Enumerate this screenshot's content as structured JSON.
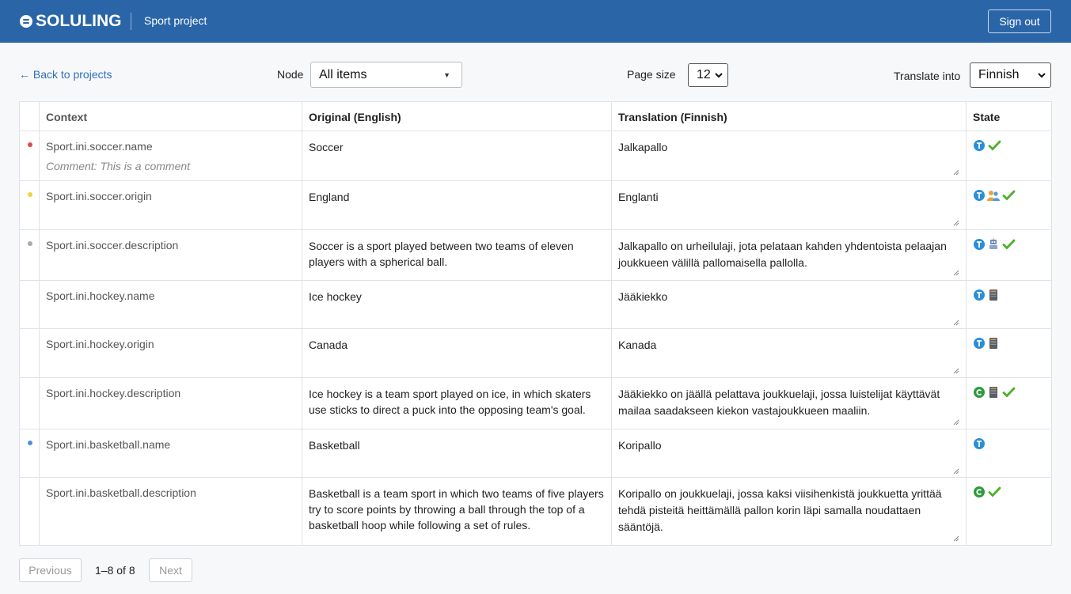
{
  "header": {
    "brand": "SOLULING",
    "project": "Sport project",
    "sign_out": "Sign out"
  },
  "toolbar": {
    "back_link": "← Back to projects",
    "node_label": "Node",
    "node_value": "All items",
    "page_size_label": "Page size",
    "page_size_value": "12",
    "translate_label": "Translate into",
    "translate_value": "Finnish"
  },
  "table": {
    "columns": [
      "Context",
      "Original (English)",
      "Translation (Finnish)",
      "State"
    ],
    "rows": [
      {
        "dot": "#e04848",
        "context": "Sport.ini.soccer.name",
        "comment": "Comment: This is a comment",
        "original": "Soccer",
        "translation": "Jalkapallo",
        "icons": [
          "t-icon",
          "check-icon"
        ]
      },
      {
        "dot": "#f2d43a",
        "context": "Sport.ini.soccer.origin",
        "comment": "",
        "original": "England",
        "translation": "Englanti",
        "icons": [
          "t-icon",
          "users-icon",
          "check-icon"
        ]
      },
      {
        "dot": "#aaaaaa",
        "context": "Sport.ini.soccer.description",
        "comment": "",
        "original": "Soccer is a sport played between two teams of eleven players with a spherical ball.",
        "translation": "Jalkapallo on urheilulaji, jota pelataan kahden yhdentoista pelaajan joukkueen välillä pallomaisella pallolla.",
        "icons": [
          "t-icon",
          "robot-icon",
          "check-icon"
        ]
      },
      {
        "dot": "",
        "context": "Sport.ini.hockey.name",
        "comment": "",
        "original": "Ice hockey",
        "translation": "Jääkiekko",
        "icons": [
          "t-icon",
          "memory-icon"
        ]
      },
      {
        "dot": "",
        "context": "Sport.ini.hockey.origin",
        "comment": "",
        "original": "Canada",
        "translation": "Kanada",
        "icons": [
          "t-icon",
          "memory-icon"
        ]
      },
      {
        "dot": "",
        "context": "Sport.ini.hockey.description",
        "comment": "",
        "original": "Ice hockey is a team sport played on ice, in which skaters use sticks to direct a puck into the opposing team's goal.",
        "translation": "Jääkiekko on jäällä pelattava joukkuelaji, jossa luistelijat käyttävät mailaa saadakseen kiekon vastajoukkueen maaliin.",
        "icons": [
          "c-icon",
          "memory-icon",
          "check-icon"
        ]
      },
      {
        "dot": "#4a90e2",
        "context": "Sport.ini.basketball.name",
        "comment": "",
        "original": "Basketball",
        "translation": "Koripallo",
        "icons": [
          "t-icon"
        ]
      },
      {
        "dot": "",
        "context": "Sport.ini.basketball.description",
        "comment": "",
        "original": "Basketball is a team sport in which two teams of five players try to score points by throwing a ball through the top of a basketball hoop while following a set of rules.",
        "translation": "Koripallo on joukkuelaji, jossa kaksi viisihenkistä joukkuetta yrittää tehdä pisteitä heittämällä pallon korin läpi samalla noudattaen sääntöjä.",
        "icons": [
          "c-icon",
          "check-icon"
        ]
      }
    ]
  },
  "pager": {
    "previous": "Previous",
    "info": "1–8 of 8",
    "next": "Next"
  },
  "colors": {
    "header_bg": "#2a65a8",
    "link": "#2f6fc0",
    "t_badge": "#2b8fd8",
    "c_badge": "#2e9b3c",
    "check": "#4cb02a"
  }
}
